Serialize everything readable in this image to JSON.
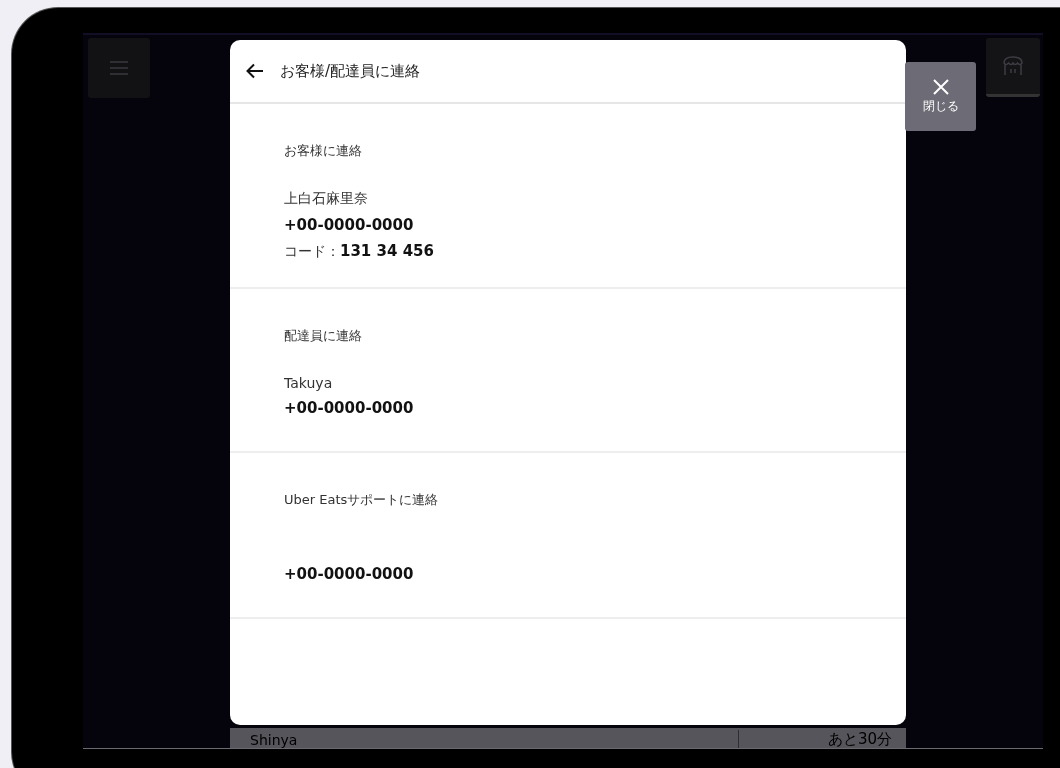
{
  "dialog": {
    "title": "お客様/配達員に連絡",
    "sections": [
      {
        "heading": "お客様に連絡",
        "name": "上白石麻里奈",
        "phone": "+00-0000-0000",
        "code": "コード：**131 34 456**"
      },
      {
        "heading": "配達員に連絡",
        "name": "Takuya",
        "phone": "+00-0000-0000"
      },
      {
        "heading": "Uber Eatsサポートに連絡",
        "phone": "+00-0000-0000"
      }
    ]
  },
  "close_button": {
    "label": "閉じる"
  },
  "order_row": {
    "customer": "Shinya",
    "time": "あと30分"
  }
}
